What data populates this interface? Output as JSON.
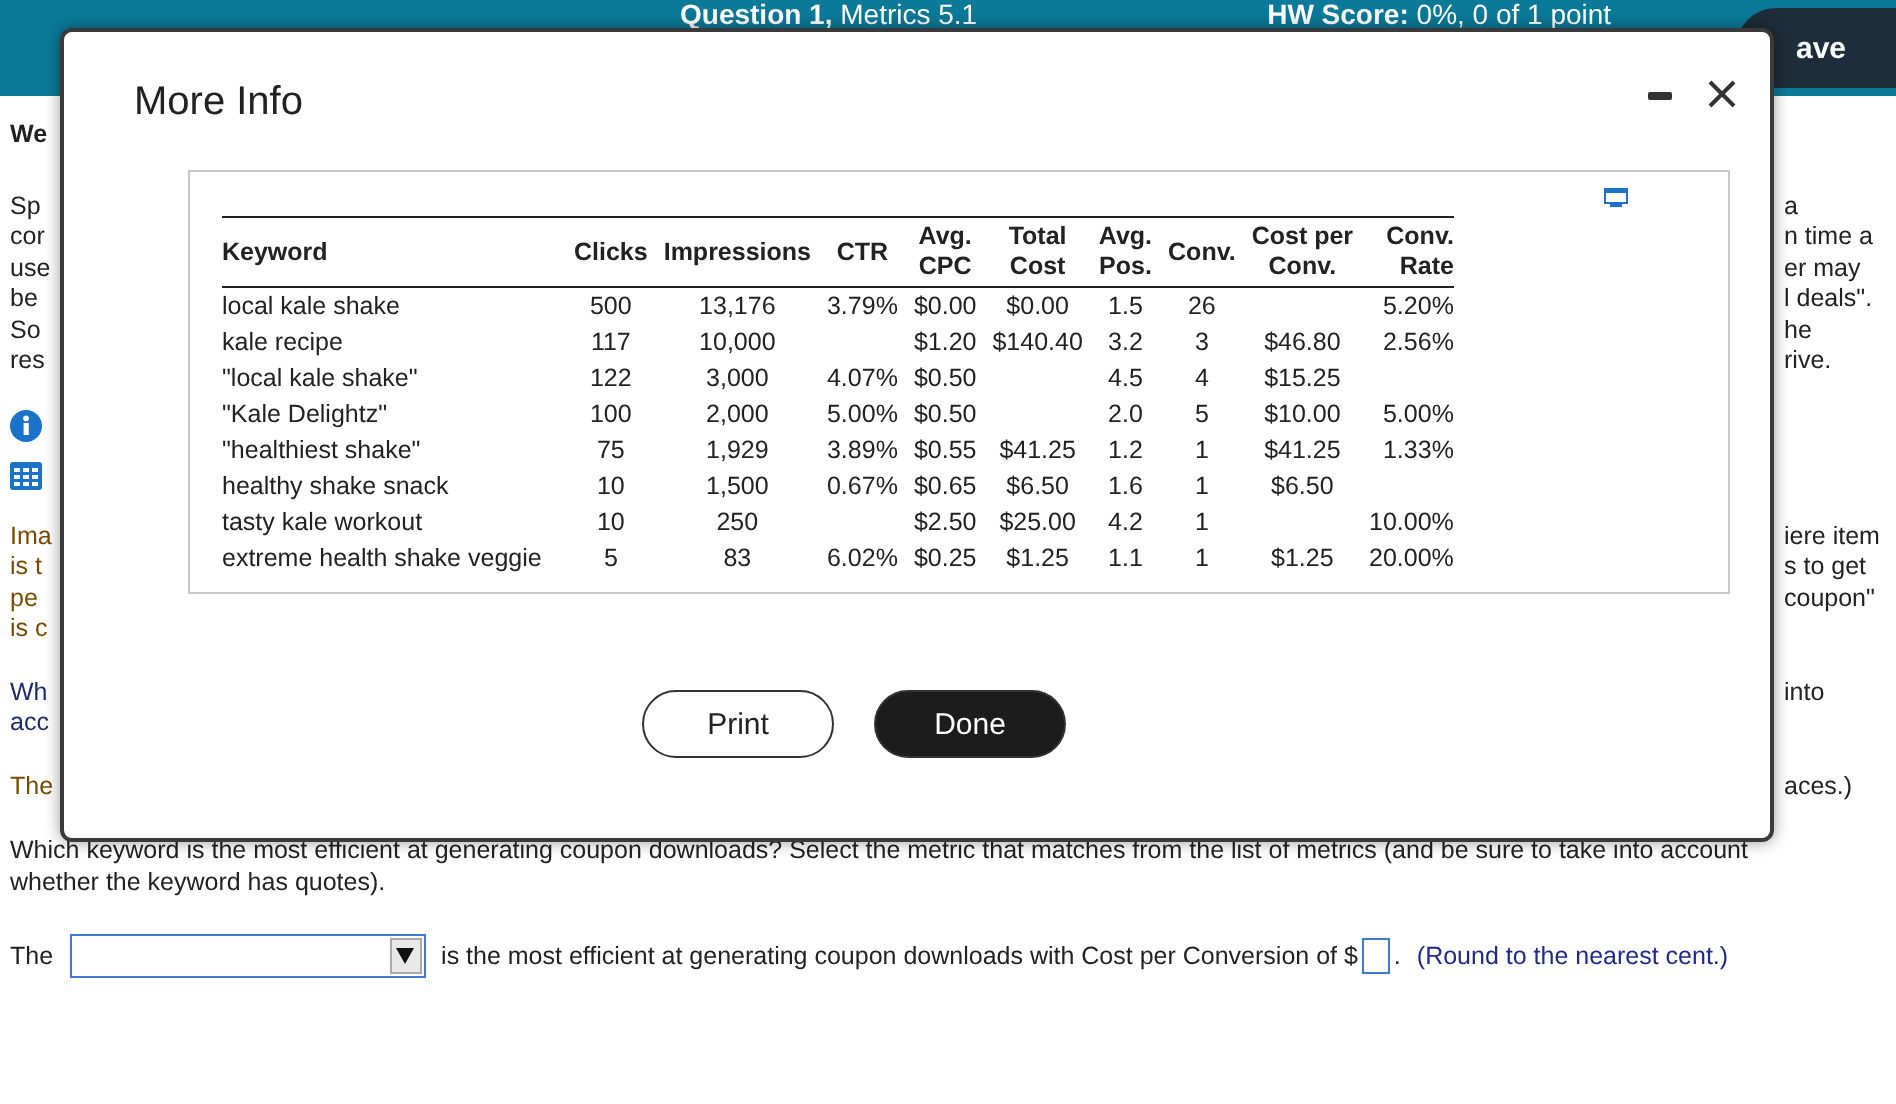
{
  "header": {
    "question": "**Question 1,** Metrics 5.1",
    "score": "**HW Score:** 0%, 0 of 1 point",
    "save_button": "ave"
  },
  "background": [
    {
      "left": {
        "kind": "heading",
        "lines": [
          "We"
        ]
      }
    },
    {
      "left": {
        "kind": "text",
        "lines": [
          "Sp",
          "cor",
          "use",
          "be",
          "So",
          "res"
        ]
      },
      "right": [
        "a",
        "n time a",
        "er may",
        "l deals\".",
        "he",
        "rive."
      ]
    },
    {
      "left": {
        "kind": "icons"
      }
    },
    {
      "left": {
        "kind": "brown",
        "lines": [
          "Ima",
          "is t",
          "pe",
          "is c"
        ]
      },
      "right": [
        "iere item",
        "s to get",
        "coupon\""
      ]
    },
    {
      "left": {
        "kind": "blue",
        "lines": [
          "Wh",
          "acc"
        ]
      },
      "right": [
        "into"
      ]
    },
    {
      "left": {
        "kind": "brown",
        "lines": [
          "The"
        ]
      },
      "right": [
        "aces.)"
      ]
    }
  ],
  "modal": {
    "title": "More Info",
    "columns": [
      "Keyword",
      "Clicks",
      "Impressions",
      "CTR",
      "Avg.\nCPC",
      "Total\nCost",
      "Avg.\nPos.",
      "Conv.",
      "Cost per\nConv.",
      "Conv.\nRate"
    ],
    "rows": [
      [
        "local kale shake",
        "500",
        "13,176",
        "3.79%",
        "$0.00",
        "$0.00",
        "1.5",
        "26",
        "",
        "5.20%"
      ],
      [
        "kale recipe",
        "117",
        "10,000",
        "",
        "$1.20",
        "$140.40",
        "3.2",
        "3",
        "$46.80",
        "2.56%"
      ],
      [
        "\"local kale shake\"",
        "122",
        "3,000",
        "4.07%",
        "$0.50",
        "",
        "4.5",
        "4",
        "$15.25",
        ""
      ],
      [
        "\"Kale Delightz\"",
        "100",
        "2,000",
        "5.00%",
        "$0.50",
        "",
        "2.0",
        "5",
        "$10.00",
        "5.00%"
      ],
      [
        "\"healthiest shake\"",
        "75",
        "1,929",
        "3.89%",
        "$0.55",
        "$41.25",
        "1.2",
        "1",
        "$41.25",
        "1.33%"
      ],
      [
        "healthy shake snack",
        "10",
        "1,500",
        "0.67%",
        "$0.65",
        "$6.50",
        "1.6",
        "1",
        "$6.50",
        ""
      ],
      [
        "tasty kale workout",
        "10",
        "250",
        "",
        "$2.50",
        "$25.00",
        "4.2",
        "1",
        "",
        "10.00%"
      ],
      [
        "extreme health shake veggie",
        "5",
        "83",
        "6.02%",
        "$0.25",
        "$1.25",
        "1.1",
        "1",
        "$1.25",
        "20.00%"
      ]
    ],
    "buttons": [
      {
        "label": "Print",
        "kind": "secondary"
      },
      {
        "label": "Done",
        "kind": "primary"
      }
    ]
  },
  "question": {
    "text": "Which keyword is the most efficient at generating coupon downloads? Select the metric that matches from the list of metrics (and be sure to take into account whether the keyword has quotes).",
    "answer_prefix": "The",
    "answer_middle": "is the most efficient at generating coupon downloads with Cost per Conversion of $",
    "answer_end": ".",
    "hint": "(Round to the nearest cent.)"
  }
}
